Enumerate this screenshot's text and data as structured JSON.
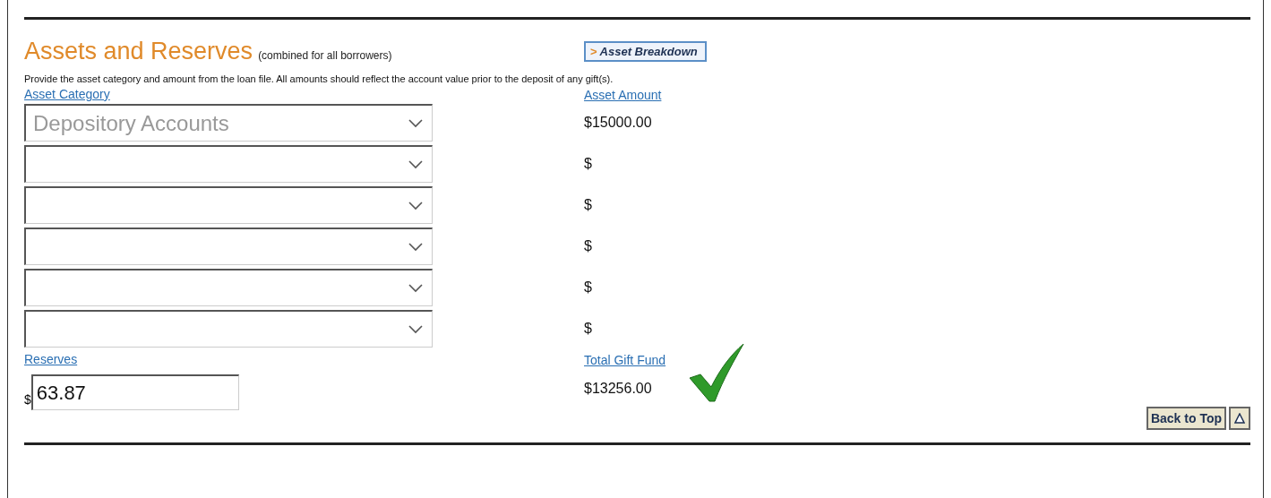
{
  "section": {
    "title": "Assets and Reserves",
    "subtitle": "(combined for all borrowers)",
    "breakdown_button": {
      "arrow": ">",
      "label": "Asset Breakdown"
    },
    "instructions": "Provide the asset category and amount from the loan file. All amounts should reflect the account value prior to the deposit of any gift(s)."
  },
  "assets": {
    "category_heading": "Asset Category",
    "amount_heading": "Asset Amount",
    "rows": [
      {
        "category": "Depository Accounts",
        "amount": "$15000.00"
      },
      {
        "amount": "$"
      },
      {
        "amount": "$"
      },
      {
        "amount": "$"
      },
      {
        "amount": "$"
      },
      {
        "amount": "$"
      }
    ]
  },
  "reserves": {
    "heading": "Reserves",
    "currency": "$",
    "value": "63.87"
  },
  "gift_fund": {
    "heading": "Total Gift Fund",
    "amount": "$13256.00",
    "verified": true
  },
  "back_to_top": {
    "label": "Back to Top"
  }
}
